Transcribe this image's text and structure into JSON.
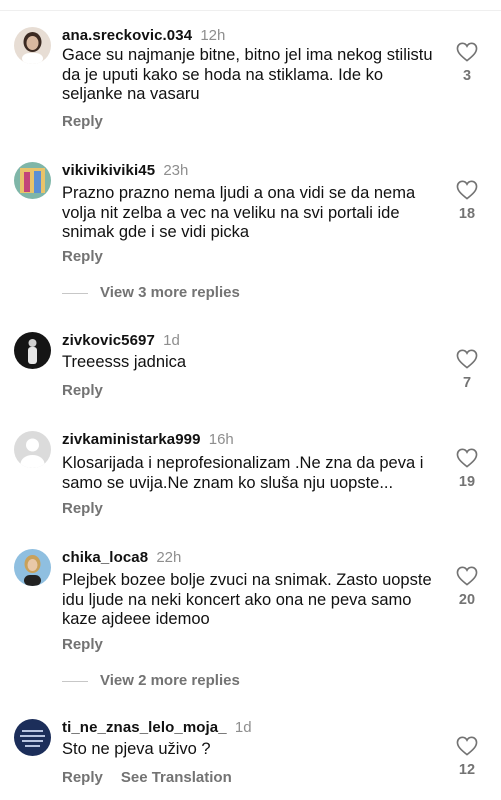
{
  "comments": [
    {
      "username": "ana.sreckovic.034",
      "time": "12h",
      "text": "Gace su najmanje bitne, bitno jel ima nekog stilistu da je uputi kako se hoda na stiklama. Ide ko seljanke na vasaru",
      "likes": "3",
      "reply_label": "Reply",
      "avatar_color": "#c9b7a8"
    },
    {
      "username": "vikivikiviki45",
      "time": "23h",
      "text": "Prazno prazno nema ljudi a ona vidi se da nema volja nit zelba a vec na veliku na svi portali  ide snimak gde i se vidi picka",
      "likes": "18",
      "reply_label": "Reply",
      "view_replies": "View 3 more replies",
      "avatar_color": "#e0b25a"
    },
    {
      "username": "zivkovic5697",
      "time": "1d",
      "text": "Treeesss jadnica",
      "likes": "7",
      "reply_label": "Reply",
      "avatar_color": "#1a1a1a"
    },
    {
      "username": "zivkaministarka999",
      "time": "16h",
      "text": "Klosarijada i neprofesionalizam .Ne  zna da peva i samo se uvija.Ne znam ko sluša nju uopste...",
      "likes": "19",
      "reply_label": "Reply",
      "avatar_color": "#dbdbdb"
    },
    {
      "username": "chika_loca8",
      "time": "22h",
      "text": "Plejbek bozee bolje zvuci na snimak. Zasto uopste idu ljude na neki koncert ako ona ne peva samo kaze ajdeee idemoo",
      "likes": "20",
      "reply_label": "Reply",
      "view_replies": "View 2 more replies",
      "avatar_color": "#7fb0d6"
    },
    {
      "username": "ti_ne_znas_lelo_moja_",
      "time": "1d",
      "text": "Sto ne pjeva uživo ?",
      "likes": "12",
      "reply_label": "Reply",
      "translate_label": "See Translation",
      "avatar_color": "#1c2e5a"
    }
  ]
}
